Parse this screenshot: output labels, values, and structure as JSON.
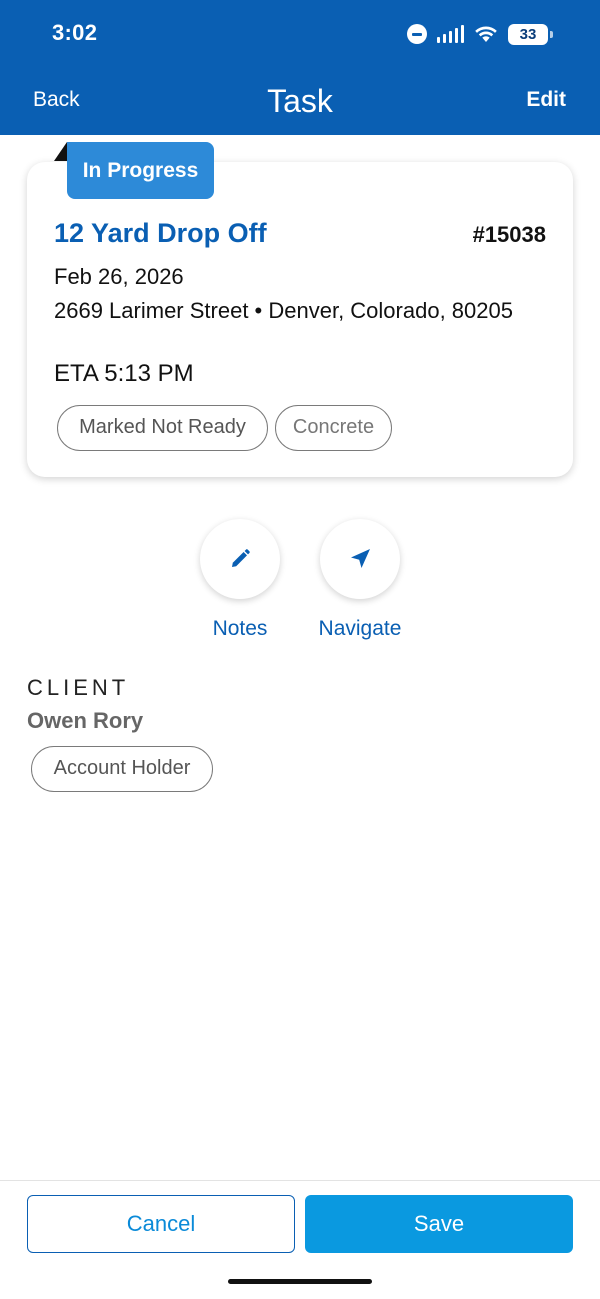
{
  "status_bar": {
    "time": "3:02",
    "battery": "33",
    "icons": [
      "do-not-disturb-icon",
      "cellular-signal-icon",
      "wifi-icon",
      "battery-icon"
    ]
  },
  "nav": {
    "back_label": "Back",
    "title": "Task",
    "edit_label": "Edit"
  },
  "task": {
    "status": "In Progress",
    "title": "12 Yard Drop Off",
    "number": "#15038",
    "date": "Feb 26, 2026",
    "address": "2669 Larimer Street • Denver, Colorado, 80205",
    "eta": "ETA 5:13 PM",
    "tags": [
      "Marked Not Ready",
      "Concrete"
    ]
  },
  "actions": {
    "notes_label": "Notes",
    "notes_icon": "pencil-icon",
    "navigate_label": "Navigate",
    "navigate_icon": "navigation-arrow-icon"
  },
  "client": {
    "heading": "CLIENT",
    "name": "Owen Rory",
    "role": "Account Holder"
  },
  "footer": {
    "cancel_label": "Cancel",
    "save_label": "Save"
  },
  "colors": {
    "header": "#0a5fb3",
    "status_ribbon": "#2d8ad8",
    "primary_text": "#0a5fb3",
    "save_button": "#0a99e0"
  }
}
